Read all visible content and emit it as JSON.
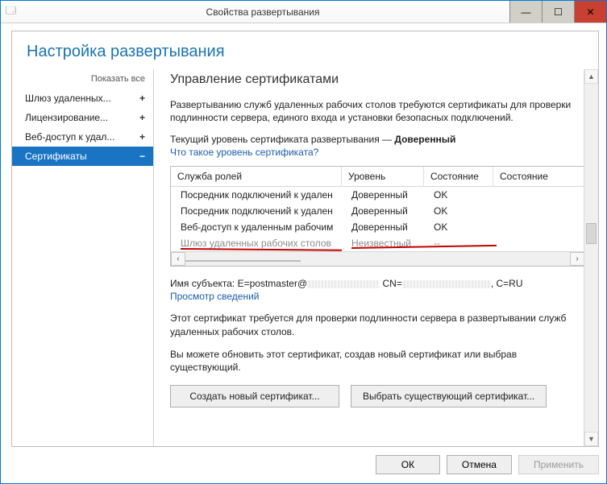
{
  "window": {
    "title": "Свойства развертывания"
  },
  "page": {
    "heading": "Настройка развертывания",
    "section_title": "Управление сертификатами"
  },
  "nav": {
    "show_all": "Показать все",
    "items": [
      {
        "label": "Шлюз удаленных...",
        "symbol": "+"
      },
      {
        "label": "Лицензирование...",
        "symbol": "+"
      },
      {
        "label": "Веб-доступ к удал...",
        "symbol": "+"
      },
      {
        "label": "Сертификаты",
        "symbol": "−"
      }
    ]
  },
  "intro": "Развертыванию служб удаленных рабочих столов требуются сертификаты для проверки подлинности сервера, единого входа и установки безопасных подключений.",
  "level_line": {
    "prefix": "Текущий уровень сертификата развертывания — ",
    "value": "Доверенный"
  },
  "level_link": "Что такое уровень сертификата?",
  "table": {
    "headers": {
      "role": "Служба ролей",
      "level": "Уровень",
      "state": "Состояние",
      "state2": "Состояние"
    },
    "rows": [
      {
        "role": "Посредник подключений к удален",
        "level": "Доверенный",
        "state": "OK",
        "disabled": false
      },
      {
        "role": "Посредник подключений к удален",
        "level": "Доверенный",
        "state": "OK",
        "disabled": false
      },
      {
        "role": "Веб-доступ к удаленным рабочим",
        "level": "Доверенный",
        "state": "OK",
        "disabled": false
      },
      {
        "role": "Шлюз удаленных рабочих столов",
        "level": "Неизвестный",
        "state": "--",
        "disabled": true
      }
    ]
  },
  "subject": {
    "label": "Имя субъекта: ",
    "prefix": "E=postmaster@",
    "cn": "CN=",
    "suffix": ", C=RU"
  },
  "details_link": "Просмотр сведений",
  "desc2": "Этот сертификат требуется для проверки подлинности сервера в развертывании служб удаленных рабочих столов.",
  "desc3": "Вы можете обновить этот сертификат, создав новый сертификат или выбрав существующий.",
  "buttons": {
    "create": "Создать новый сертификат...",
    "select": "Выбрать существующий сертификат..."
  },
  "footer": {
    "ok": "ОК",
    "cancel": "Отмена",
    "apply": "Применить"
  }
}
